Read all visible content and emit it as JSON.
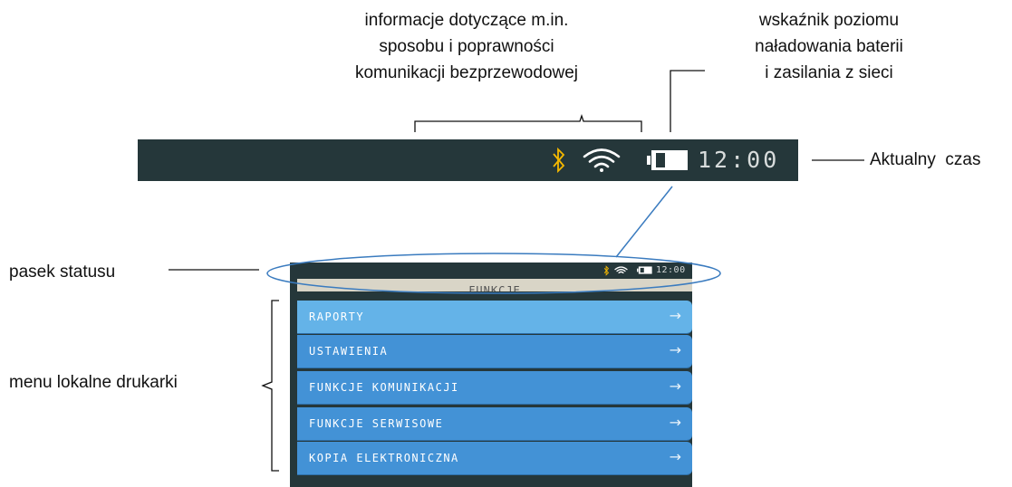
{
  "callouts": {
    "wireless_info": [
      "informacje dotyczące m.in.",
      "sposobu i poprawności",
      "komunikacji bezprzewodowej"
    ],
    "battery_indicator": [
      "wskaźnik poziomu",
      "naładowania baterii",
      "i zasilania z sieci"
    ],
    "current_time": "Aktualny  czas",
    "status_bar": "pasek statusu",
    "local_menu": "menu lokalne drukarki"
  },
  "status_bar": {
    "time": "12:00",
    "icons": [
      "bluetooth-icon",
      "wifi-icon",
      "battery-icon"
    ],
    "bluetooth_color": "#f5b800"
  },
  "device": {
    "small_time": "12:00",
    "menu_title": "FUNKCJE",
    "menu_items": [
      {
        "label": "RAPORTY",
        "active": true
      },
      {
        "label": "USTAWIENIA",
        "active": false
      },
      {
        "label": "FUNKCJE KOMUNIKACJI",
        "active": false
      },
      {
        "label": "FUNKCJE SERWISOWE",
        "active": false
      },
      {
        "label": "KOPIA ELEKTRONICZNA",
        "active": false
      }
    ],
    "arrow": "→"
  },
  "colors": {
    "bar_background": "#25373a",
    "menu_item": "#4392d6",
    "menu_item_active": "#64b3e8",
    "highlight_ellipse": "#3a7bbf"
  }
}
